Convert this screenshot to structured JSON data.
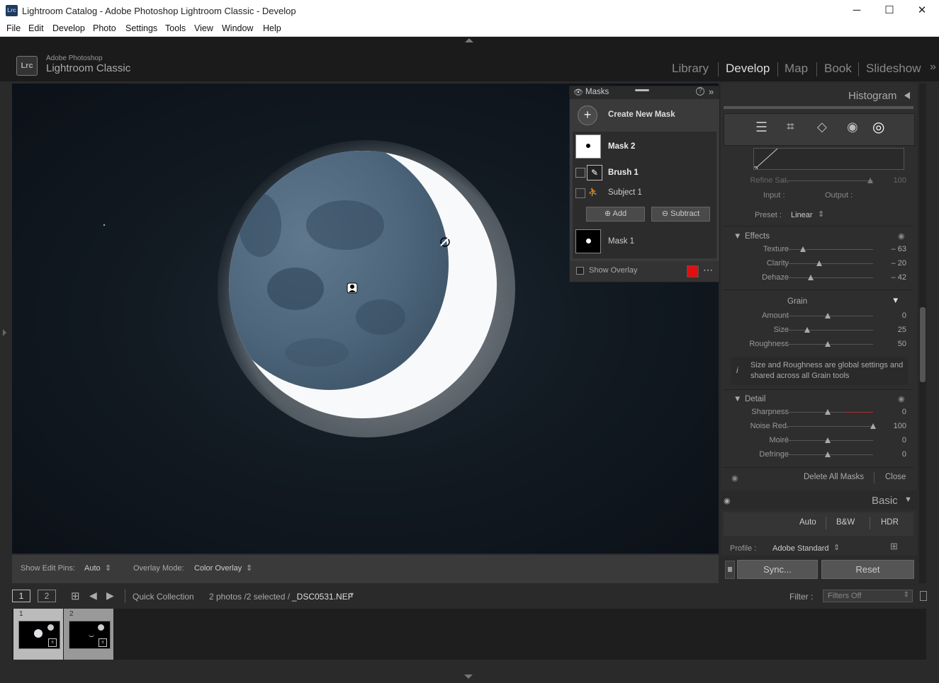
{
  "window": {
    "title": "Lightroom Catalog - Adobe Photoshop Lightroom Classic - Develop",
    "app_icon": "Lrc",
    "min": "─",
    "max": "☐",
    "close": "✕"
  },
  "menu": [
    "File",
    "Edit",
    "Develop",
    "Photo",
    "Settings",
    "Tools",
    "View",
    "Window",
    "Help"
  ],
  "header": {
    "logo": "Lrc",
    "brand_small": "Adobe Photoshop",
    "brand_big": "Lightroom Classic",
    "modules": [
      "Library",
      "Develop",
      "Map",
      "Book",
      "Slideshow"
    ]
  },
  "masks": {
    "title": "Masks",
    "create_new": "Create New Mask",
    "mask2": "Mask 2",
    "brush1": "Brush 1",
    "subject1": "Subject 1",
    "add": "Add",
    "subtract": "Subtract",
    "mask1": "Mask 1",
    "show_overlay": "Show Overlay",
    "overlay_color": "#e01010"
  },
  "right": {
    "histogram": "Histogram",
    "refine_sat": "Refine Sat.",
    "refine_sat_val": "100",
    "input": "Input :",
    "output": "Output :",
    "preset_label": "Preset :",
    "preset_value": "Linear",
    "effects": "Effects",
    "effects_sliders": [
      {
        "label": "Texture",
        "value": "– 63",
        "pos": 0.23
      },
      {
        "label": "Clarity",
        "value": "– 20",
        "pos": 0.41
      },
      {
        "label": "Dehaze",
        "value": "– 42",
        "pos": 0.32
      }
    ],
    "grain": "Grain",
    "grain_sliders": [
      {
        "label": "Amount",
        "value": "0",
        "pos": 0.5
      },
      {
        "label": "Size",
        "value": "25",
        "pos": 0.28
      },
      {
        "label": "Roughness",
        "value": "50",
        "pos": 0.5
      }
    ],
    "grain_info": "Size and Roughness are global settings and shared across all Grain tools",
    "detail": "Detail",
    "detail_sliders": [
      {
        "label": "Sharpness",
        "value": "0",
        "pos": 0.5
      },
      {
        "label": "Noise Red.",
        "value": "100",
        "pos": 1.0
      },
      {
        "label": "Moiré",
        "value": "0",
        "pos": 0.5
      },
      {
        "label": "Defringe",
        "value": "0",
        "pos": 0.5
      }
    ],
    "delete_all": "Delete All Masks",
    "close": "Close",
    "basic": "Basic",
    "auto": "Auto",
    "bw": "B&W",
    "hdr": "HDR",
    "profile_label": "Profile :",
    "profile_value": "Adobe Standard",
    "sync": "Sync...",
    "reset": "Reset"
  },
  "toolbar": {
    "show_pins_label": "Show Edit Pins:",
    "show_pins_value": "Auto",
    "overlay_mode_label": "Overlay Mode:",
    "overlay_mode_value": "Color Overlay"
  },
  "filmbar": {
    "screen1": "1",
    "screen2": "2",
    "source": "Quick Collection",
    "count": "2 photos /2 selected /",
    "file": "_DSC0531.NEF",
    "filter_label": "Filter :",
    "filter_value": "Filters Off",
    "cells": [
      "1",
      "2"
    ]
  }
}
